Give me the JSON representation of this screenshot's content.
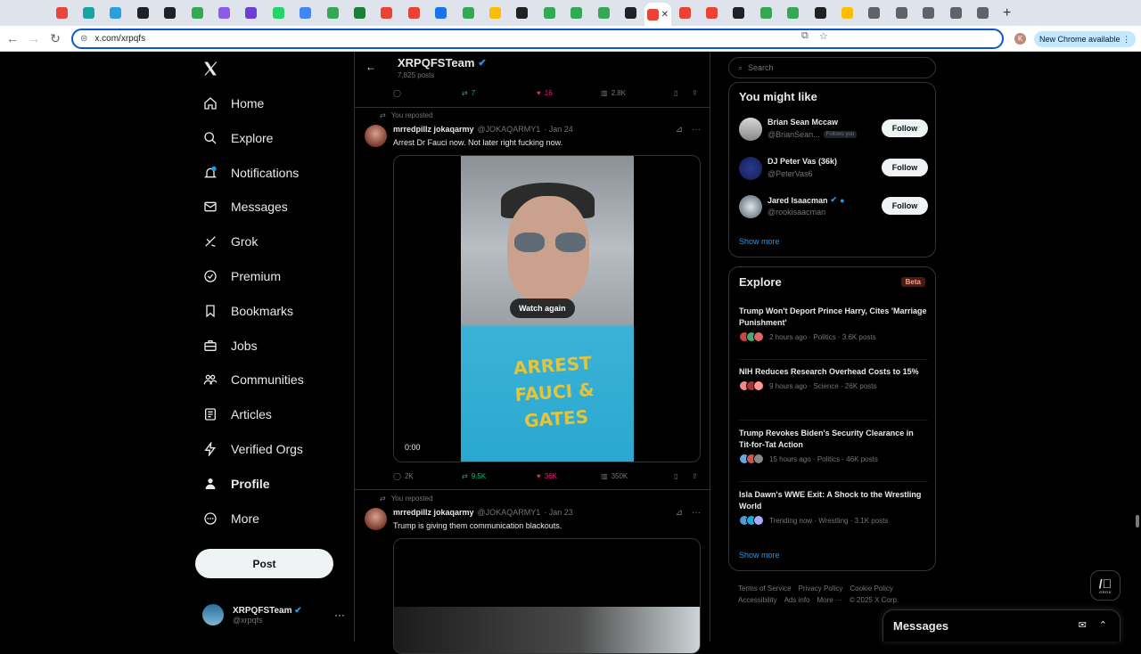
{
  "browser": {
    "address": "x.com/xrpqfs",
    "new_chrome": "New Chrome available",
    "profile_initial": "K",
    "tab_colors": [
      "#e8453c",
      "#1aa3a3",
      "#2aa1de",
      "#202124",
      "#202124",
      "#34a853",
      "#8e5be8",
      "#6b3fd6",
      "#25d366",
      "#4285f4",
      "#34a853",
      "#188038",
      "#ea4335",
      "#ea4335",
      "#1a73e8",
      "#34a853",
      "#fbbc04",
      "#202124",
      "#34a853",
      "#34a853",
      "#34a853",
      "#202124",
      "#ea4335",
      "#ea4335",
      "#ea4335",
      "#202124",
      "#34a853",
      "#34a853",
      "#202124",
      "#fbbc04",
      "#5f6368",
      "#5f6368",
      "#5f6368",
      "#5f6368",
      "#5f6368"
    ]
  },
  "nav": {
    "items": [
      {
        "label": "Home",
        "icon": "home-icon"
      },
      {
        "label": "Explore",
        "icon": "search-icon"
      },
      {
        "label": "Notifications",
        "icon": "bell-icon"
      },
      {
        "label": "Messages",
        "icon": "mail-icon"
      },
      {
        "label": "Grok",
        "icon": "grok-icon"
      },
      {
        "label": "Premium",
        "icon": "premium-icon"
      },
      {
        "label": "Bookmarks",
        "icon": "bookmark-icon"
      },
      {
        "label": "Jobs",
        "icon": "briefcase-icon"
      },
      {
        "label": "Communities",
        "icon": "people-icon"
      },
      {
        "label": "Articles",
        "icon": "article-icon"
      },
      {
        "label": "Verified Orgs",
        "icon": "lightning-icon"
      },
      {
        "label": "Profile",
        "icon": "person-icon"
      },
      {
        "label": "More",
        "icon": "more-circle-icon"
      }
    ],
    "post": "Post",
    "account": {
      "name": "XRPQFSTeam",
      "handle": "@xrpqfs"
    }
  },
  "profile_header": {
    "name": "XRPQFSTeam",
    "posts": "7,825 posts"
  },
  "top_actions": {
    "reply": "",
    "retweets": "7",
    "likes": "16",
    "views": "2.8K"
  },
  "tweets": [
    {
      "repost_label": "You reposted",
      "name": "mrredpillz jokaqarmy",
      "handle": "@JOKAQARMY1",
      "date": "· Jan 24",
      "text": "Arrest  Dr Fauci now. Not later right fucking now.",
      "video": {
        "overlay": "Watch again",
        "time": "0:00",
        "shirt_text": "ARREST FAUCI & GATES"
      },
      "actions": {
        "reply": "2K",
        "retweets": "9.5K",
        "likes": "36K",
        "views": "350K"
      }
    },
    {
      "repost_label": "You reposted",
      "name": "mrredpillz jokaqarmy",
      "handle": "@JOKAQARMY1",
      "date": "· Jan 23",
      "text": "Trump is giving them communication blackouts."
    }
  ],
  "right": {
    "search_placeholder": "Search",
    "you_might_like": {
      "title": "You might like",
      "users": [
        {
          "name": "Brian Sean Mccaw",
          "handle": "@BrianSean...",
          "follows_you": "Follows you",
          "verified": false
        },
        {
          "name": "DJ Peter Vas (36k)",
          "handle": "@PeterVas6",
          "follows_you": "",
          "verified": false
        },
        {
          "name": "Jared Isaacman",
          "handle": "@rookisaacman",
          "follows_you": "",
          "verified": true
        }
      ],
      "follow_label": "Follow",
      "show_more": "Show more"
    },
    "explore": {
      "title": "Explore",
      "badge": "Beta",
      "trends": [
        {
          "title": "Trump Won't Deport Prince Harry, Cites 'Marriage Punishment'",
          "meta": "2 hours ago · Politics · 3.6K posts"
        },
        {
          "title": "NIH Reduces Research Overhead Costs to 15%",
          "meta": "9 hours ago · Science · 26K posts"
        },
        {
          "title": "Trump Revokes Biden's Security Clearance in Tit-for-Tat Action",
          "meta": "15 hours ago · Politics · 46K posts"
        },
        {
          "title": "Isla Dawn's WWE Exit: A Shock to the Wrestling World",
          "meta": "Trending now · Wrestling · 3.1K posts"
        }
      ],
      "show_more": "Show more"
    },
    "footer": {
      "line1": [
        "Terms of Service",
        "Privacy Policy",
        "Cookie Policy"
      ],
      "line2": [
        "Accessibility",
        "Ads info",
        "More ···",
        "© 2025 X Corp."
      ]
    }
  },
  "grok_fab": {
    "label": "GROK"
  },
  "messages_drawer": {
    "title": "Messages"
  }
}
